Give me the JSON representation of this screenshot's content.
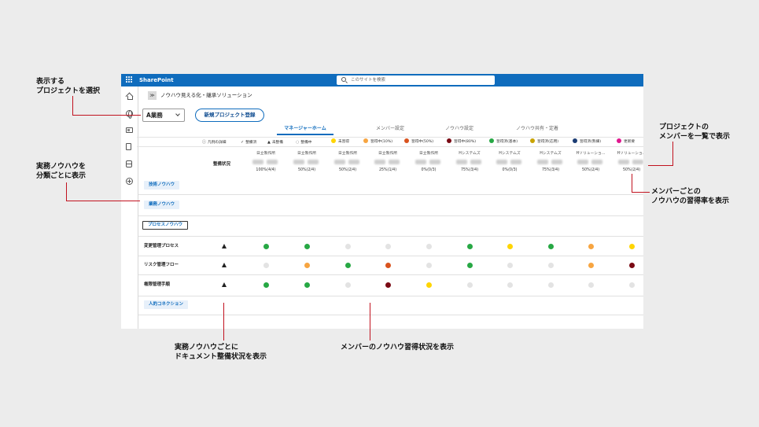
{
  "colors": {
    "brand_blue": "#0f6cbd",
    "annotation_red": "#c1121f",
    "not_learned": "#e3e3e3",
    "learning_10": "#f7a541",
    "learning_50": "#d9531e",
    "learning_80": "#7a0a14",
    "learned_basic": "#27a844",
    "learned_applied": "#e5b800",
    "learned_master": "#1b3c74",
    "update": "#e0188f",
    "unlearned_yellow": "#ffd500"
  },
  "topbar": {
    "app_name": "SharePoint",
    "search_placeholder": "このサイトを検索"
  },
  "site": {
    "logo": "≫",
    "title": "ノウハウ見える化・継承ソリューション"
  },
  "project": {
    "selected": "A業務",
    "new_button": "新規プロジェクト登録"
  },
  "tabs": [
    "マネージャーホーム",
    "メンバー設定",
    "ノウハウ設定",
    "ノウハウ共有・定着"
  ],
  "legend": {
    "detail": "凡例の詳細",
    "items": [
      {
        "sym": "✓",
        "label": "整備済"
      },
      {
        "sym": "▲",
        "label": "未整備"
      },
      {
        "sym": "◌",
        "label": "整備中"
      },
      {
        "color": "#ffd500",
        "label": "未習得"
      },
      {
        "color": "#f7a541",
        "label": "習得中(10%)"
      },
      {
        "color": "#d9531e",
        "label": "習得中(50%)"
      },
      {
        "color": "#7a0a14",
        "label": "習得中(80%)"
      },
      {
        "color": "#27a844",
        "label": "習得済(基本)"
      },
      {
        "color": "#c9a300",
        "label": "習得済(応用)"
      },
      {
        "color": "#1b3c74",
        "label": "習得済(熟練)"
      },
      {
        "color": "#e0188f",
        "label": "更新要"
      }
    ]
  },
  "grid": {
    "status_header": "整備状況",
    "members": [
      {
        "org": "日立製作所",
        "rate": "100%(4/4)"
      },
      {
        "org": "日立製作所",
        "rate": "50%(2/4)"
      },
      {
        "org": "日立製作所",
        "rate": "50%(2/4)"
      },
      {
        "org": "日立製作所",
        "rate": "25%(1/4)"
      },
      {
        "org": "日立製作所",
        "rate": "0%(0/3)"
      },
      {
        "org": "Hシステムズ",
        "rate": "75%(3/4)"
      },
      {
        "org": "Hシステムズ",
        "rate": "0%(0/3)"
      },
      {
        "org": "Hシステムズ",
        "rate": "75%(3/4)"
      },
      {
        "org": "Hソリューショ...",
        "rate": "50%(2/4)"
      },
      {
        "org": "Hソリューショ...",
        "rate": "50%(2/4)"
      }
    ],
    "categories": [
      "技術ノウハウ",
      "業務ノウハウ",
      "プロセスノウハウ",
      "人的コネクション"
    ],
    "knowhow_rows": [
      {
        "name": "変更管理プロセス",
        "doc": "▲",
        "cells": [
          "#27a844",
          "#27a844",
          "#e3e3e3",
          "#e3e3e3",
          "#e3e3e3",
          "#27a844",
          "#ffd500",
          "#27a844",
          "#f7a541",
          "#ffd500"
        ]
      },
      {
        "name": "リスク管理フロー",
        "doc": "▲",
        "cells": [
          "#e3e3e3",
          "#f7a541",
          "#27a844",
          "#d9531e",
          "#e3e3e3",
          "#27a844",
          "#e3e3e3",
          "#e3e3e3",
          "#f7a541",
          "#7a0a14"
        ]
      },
      {
        "name": "権限管理手順",
        "doc": "▲",
        "cells": [
          "#27a844",
          "#27a844",
          "#e3e3e3",
          "#7a0a14",
          "#ffd500",
          "#e3e3e3",
          "#e3e3e3",
          "#e3e3e3",
          "#e3e3e3",
          "#e3e3e3"
        ]
      }
    ]
  },
  "annotations": {
    "select_project": [
      "表示する",
      "プロジェクトを選択"
    ],
    "classify": [
      "実務ノウハウを",
      "分類ごとに表示"
    ],
    "member_list": [
      "プロジェクトの",
      "メンバーを一覧で表示"
    ],
    "member_rate": [
      "メンバーごとの",
      "ノウハウの習得率を表示"
    ],
    "doc_status": [
      "実務ノウハウごとに",
      "ドキュメント整備状況を表示"
    ],
    "learning_status": [
      "メンバーのノウハウ習得状況を表示"
    ]
  }
}
